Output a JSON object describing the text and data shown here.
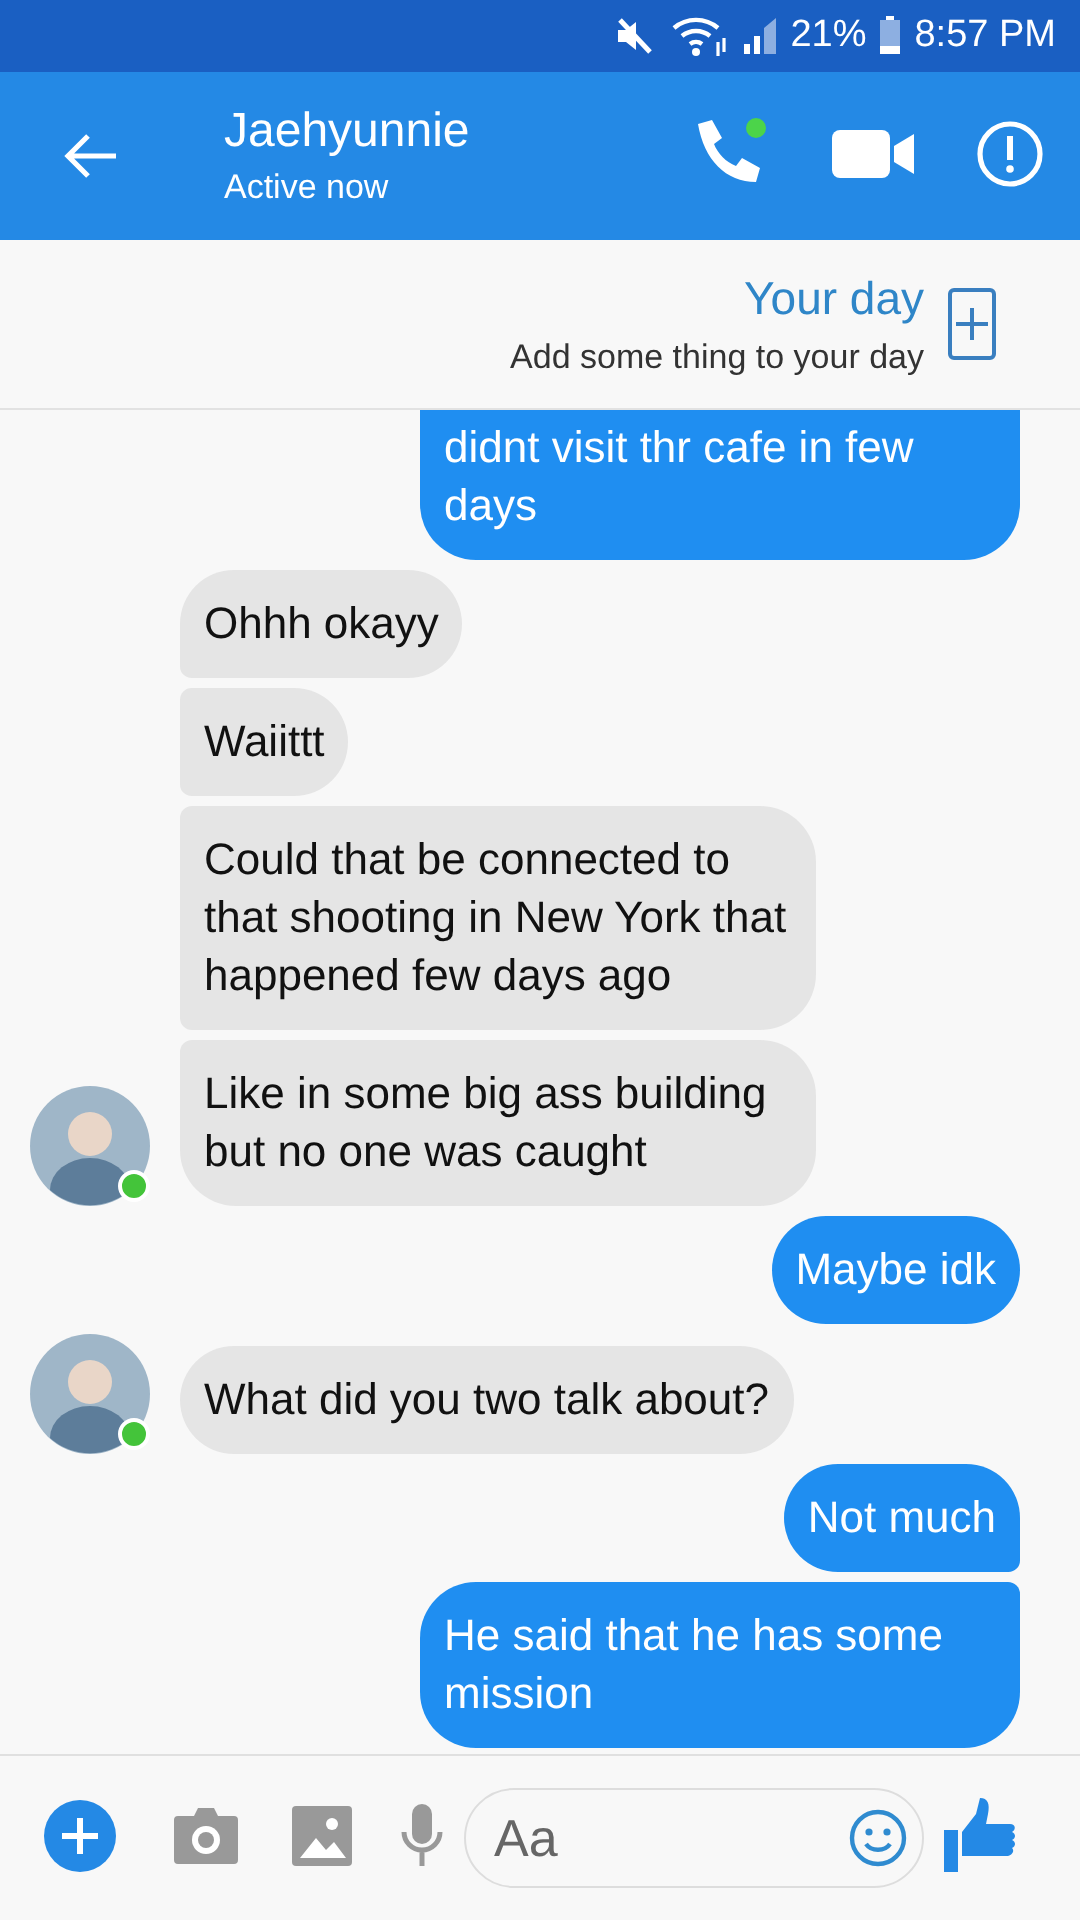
{
  "status_bar": {
    "battery": "21%",
    "time": "8:57 PM"
  },
  "header": {
    "title": "Jaehyunnie",
    "subtitle": "Active now"
  },
  "your_day": {
    "title": "Your day",
    "subtitle": "Add some thing to your day"
  },
  "messages": [
    {
      "kind": "sent",
      "text": "didnt visit thr cafe in few days",
      "cut_top": true
    },
    {
      "kind": "received",
      "text": "Ohhh okayy"
    },
    {
      "kind": "received",
      "text": "Waiittt"
    },
    {
      "kind": "received",
      "text": "Could that be connected to that shooting in New York that happened few days ago"
    },
    {
      "kind": "received",
      "text": "Like in some big ass building but no one was caught",
      "avatar": {
        "online": true
      }
    },
    {
      "kind": "sent",
      "text": "Maybe idk"
    },
    {
      "kind": "received",
      "text": "What did you two talk about?",
      "avatar": {
        "online": true
      }
    },
    {
      "kind": "sent",
      "text": "Not much"
    },
    {
      "kind": "sent",
      "text": "He said that he has some mission"
    }
  ],
  "composer": {
    "placeholder": "Aa"
  }
}
